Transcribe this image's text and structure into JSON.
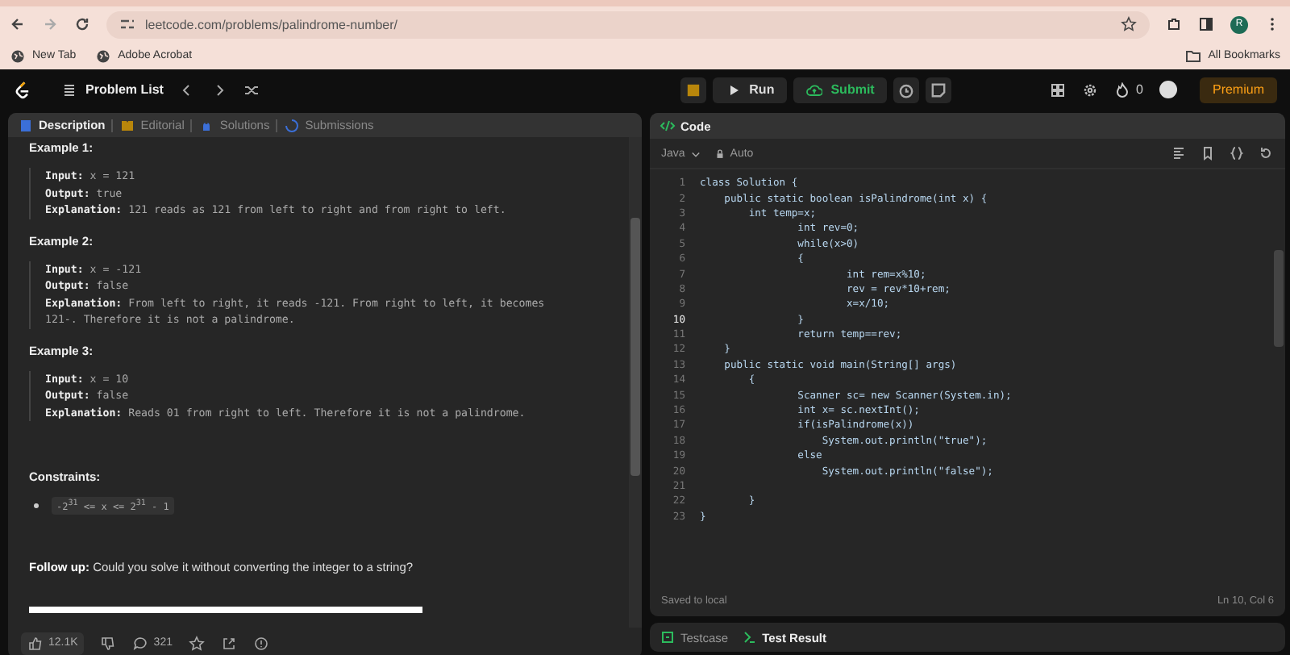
{
  "browser": {
    "url": "leetcode.com/problems/palindrome-number/",
    "bookmarks": [
      {
        "label": "New Tab"
      },
      {
        "label": "Adobe Acrobat"
      }
    ],
    "all_bookmarks": "All Bookmarks",
    "profile_initial": "R"
  },
  "topbar": {
    "problem_list": "Problem List",
    "run": "Run",
    "submit": "Submit",
    "streak": "0",
    "premium": "Premium"
  },
  "left_tabs": [
    {
      "label": "Description",
      "selected": true
    },
    {
      "label": "Editorial",
      "selected": false
    },
    {
      "label": "Solutions",
      "selected": false
    },
    {
      "label": "Submissions",
      "selected": false
    }
  ],
  "examples": [
    {
      "title": "Example 1:",
      "input": "**Input:** x = 121",
      "output": "**Output:** true",
      "explanation": "**Explanation:** 121 reads as 121 from left to right and from right to left."
    },
    {
      "title": "Example 2:",
      "input": "**Input:** x = -121",
      "output": "**Output:** false",
      "explanation": "**Explanation:** From left to right, it reads -121. From right to left, it becomes 121-. Therefore it is not a palindrome."
    },
    {
      "title": "Example 3:",
      "input": "**Input:** x = 10",
      "output": "**Output:** false",
      "explanation": "**Explanation:** Reads 01 from right to left. Therefore it is not a palindrome."
    }
  ],
  "constraints_title": "Constraints:",
  "constraints": [
    "-2$^{31}$ <= x <= 2$^{31}$ - 1"
  ],
  "follow_up": "**Follow up:** Could you solve it without converting the integer to a string?",
  "footer": {
    "likes": "12.1K",
    "comments": "321"
  },
  "code_panel": {
    "title": "Code",
    "language": "Java",
    "mode": "Auto",
    "lines": [
      {
        "number": "1",
        "text": "class Solution {",
        "current": false
      },
      {
        "number": "2",
        "text": "    public static boolean isPalindrome(int x) {",
        "current": false
      },
      {
        "number": "3",
        "text": "        int temp=x;",
        "current": false
      },
      {
        "number": "4",
        "text": "                int rev=0;",
        "current": false
      },
      {
        "number": "5",
        "text": "                while(x>0)",
        "current": false
      },
      {
        "number": "6",
        "text": "                {",
        "current": false
      },
      {
        "number": "7",
        "text": "                        int rem=x%10;",
        "current": false
      },
      {
        "number": "8",
        "text": "                        rev = rev*10+rem;",
        "current": false
      },
      {
        "number": "9",
        "text": "                        x=x/10;",
        "current": false
      },
      {
        "number": "10",
        "text": "                }",
        "current": true
      },
      {
        "number": "11",
        "text": "                return temp==rev;",
        "current": false
      },
      {
        "number": "12",
        "text": "    }",
        "current": false
      },
      {
        "number": "13",
        "text": "    public static void main(String[] args)",
        "current": false
      },
      {
        "number": "14",
        "text": "        {",
        "current": false
      },
      {
        "number": "15",
        "text": "                Scanner sc= new Scanner(System.in);",
        "current": false
      },
      {
        "number": "16",
        "text": "                int x= sc.nextInt();",
        "current": false
      },
      {
        "number": "17",
        "text": "                if(isPalindrome(x))",
        "current": false
      },
      {
        "number": "18",
        "text": "                    System.out.println(\"true\");",
        "current": false
      },
      {
        "number": "19",
        "text": "                else",
        "current": false
      },
      {
        "number": "20",
        "text": "                    System.out.println(\"false\");",
        "current": false
      },
      {
        "number": "21",
        "current": false
      },
      {
        "number": "22",
        "text": "        }",
        "current": false
      },
      {
        "number": "23",
        "text": "}",
        "current": false
      }
    ],
    "saved": "Saved to local",
    "cursor": "Ln 10, Col 6"
  },
  "bottom_tabs": [
    {
      "label": "Testcase",
      "selected": false
    },
    {
      "label": "Test Result",
      "selected": true
    }
  ]
}
